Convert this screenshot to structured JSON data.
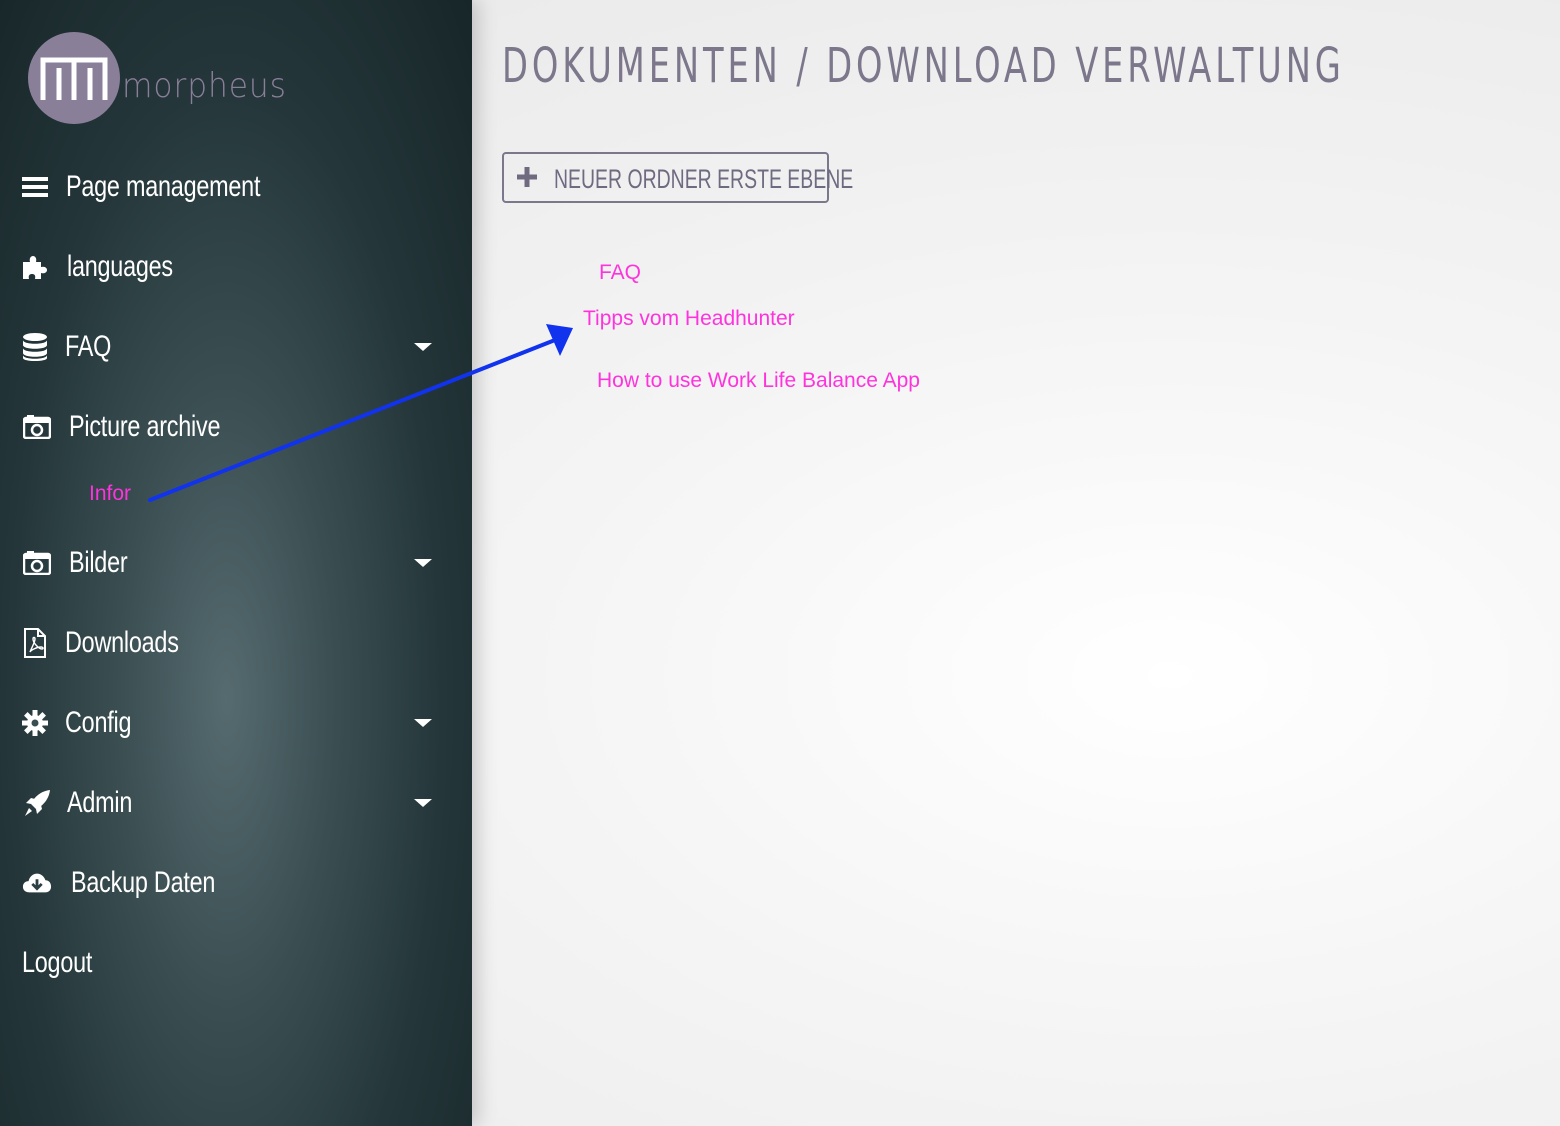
{
  "logo": {
    "text": "morpheus"
  },
  "sidebar": {
    "items": [
      {
        "label": "Page management",
        "icon": "bars-icon",
        "caret": false
      },
      {
        "label": "languages",
        "icon": "puzzle-icon",
        "caret": false
      },
      {
        "label": "FAQ",
        "icon": "database-icon",
        "caret": true
      },
      {
        "label": "Picture archive",
        "icon": "camera-icon",
        "caret": false
      },
      {
        "label": "Bilder",
        "icon": "camera-icon",
        "caret": true
      },
      {
        "label": "Downloads",
        "icon": "pdf-file-icon",
        "caret": false
      },
      {
        "label": "Config",
        "icon": "gear-icon",
        "caret": true
      },
      {
        "label": "Admin",
        "icon": "rocket-icon",
        "caret": true
      },
      {
        "label": "Backup Daten",
        "icon": "cloud-download-icon",
        "caret": false
      },
      {
        "label": "Logout",
        "icon": "",
        "caret": false
      }
    ],
    "annotation_label": "Infor"
  },
  "main": {
    "title": "DOKUMENTEN / DOWNLOAD VERWALTUNG",
    "new_folder_button": "NEUER ORDNER ERSTE EBENE",
    "folders": [
      "FAQ",
      "Tipps vom Headhunter",
      "How to use Work Life Balance App"
    ]
  },
  "colors": {
    "accent_text": "#7d778c",
    "annotation_pink": "#ff33dd",
    "annotation_arrow": "#1133ee",
    "logo_purple": "#8a7f99"
  }
}
